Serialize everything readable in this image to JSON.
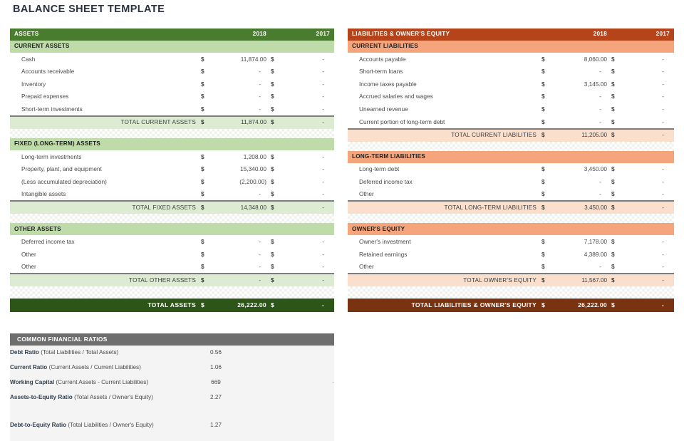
{
  "page": {
    "title": "BALANCE SHEET TEMPLATE"
  },
  "colors": {
    "assets_header": "#4a7c2f",
    "assets_subheader": "#bedba9",
    "assets_total": "#dcebd1",
    "assets_grand": "#2e5518",
    "liabilities_header": "#b5441a",
    "liabilities_subheader": "#f4a57c",
    "liabilities_total": "#fadfcd",
    "liabilities_grand": "#7a3311",
    "ratios_header": "#6e6e6e",
    "title_color": "#2b3342"
  },
  "currency_symbol": "$",
  "dash": "-",
  "assets": {
    "header": {
      "title": "ASSETS",
      "year1": "2018",
      "year2": "2017"
    },
    "sections": [
      {
        "name": "CURRENT ASSETS",
        "rows": [
          {
            "label": "Cash",
            "v2018": "11,874.00",
            "v2017": "-"
          },
          {
            "label": "Accounts receivable",
            "v2018": "-",
            "v2017": "-"
          },
          {
            "label": "Inventory",
            "v2018": "-",
            "v2017": "-"
          },
          {
            "label": "Prepaid expenses",
            "v2018": "-",
            "v2017": "-"
          },
          {
            "label": "Short-term investments",
            "v2018": "-",
            "v2017": "-"
          }
        ],
        "total": {
          "label": "TOTAL CURRENT ASSETS",
          "v2018": "11,874.00",
          "v2017": "-"
        }
      },
      {
        "name": "FIXED (LONG-TERM) ASSETS",
        "rows": [
          {
            "label": "Long-term investments",
            "v2018": "1,208.00",
            "v2017": "-"
          },
          {
            "label": "Property, plant, and equipment",
            "v2018": "15,340.00",
            "v2017": "-"
          },
          {
            "label": "(Less accumulated depreciation)",
            "v2018": "(2,200.00)",
            "v2017": "-"
          },
          {
            "label": "Intangible assets",
            "v2018": "-",
            "v2017": "-"
          }
        ],
        "total": {
          "label": "TOTAL FIXED ASSETS",
          "v2018": "14,348.00",
          "v2017": "-"
        }
      },
      {
        "name": "OTHER ASSETS",
        "rows": [
          {
            "label": "Deferred income tax",
            "v2018": "-",
            "v2017": "-"
          },
          {
            "label": "Other",
            "v2018": "-",
            "v2017": "-"
          },
          {
            "label": "Other",
            "v2018": "-",
            "v2017": "-"
          }
        ],
        "total": {
          "label": "TOTAL OTHER ASSETS",
          "v2018": "-",
          "v2017": "-"
        }
      }
    ],
    "grand_total": {
      "label": "TOTAL ASSETS",
      "v2018": "26,222.00",
      "v2017": "-"
    }
  },
  "liabilities": {
    "header": {
      "title": "LIABILITIES & OWNER'S EQUITY",
      "year1": "2018",
      "year2": "2017"
    },
    "sections": [
      {
        "name": "CURRENT LIABILITIES",
        "rows": [
          {
            "label": "Accounts payable",
            "v2018": "8,060.00",
            "v2017": "-"
          },
          {
            "label": "Short-term loans",
            "v2018": "-",
            "v2017": "-"
          },
          {
            "label": "Income taxes payable",
            "v2018": "3,145.00",
            "v2017": "-"
          },
          {
            "label": "Accrued salaries and wages",
            "v2018": "-",
            "v2017": "-"
          },
          {
            "label": "Unearned revenue",
            "v2018": "-",
            "v2017": "-"
          },
          {
            "label": "Current portion of long-term debt",
            "v2018": "-",
            "v2017": "-"
          }
        ],
        "total": {
          "label": "TOTAL CURRENT LIABILITIES",
          "v2018": "11,205.00",
          "v2017": "-"
        }
      },
      {
        "name": "LONG-TERM LIABILITIES",
        "rows": [
          {
            "label": "Long-term debt",
            "v2018": "3,450.00",
            "v2017": "-"
          },
          {
            "label": "Deferred income tax",
            "v2018": "-",
            "v2017": "-"
          },
          {
            "label": "Other",
            "v2018": "-",
            "v2017": "-"
          }
        ],
        "total": {
          "label": "TOTAL LONG-TERM LIABILITIES",
          "v2018": "3,450.00",
          "v2017": "-"
        }
      },
      {
        "name": "OWNER'S EQUITY",
        "rows": [
          {
            "label": "Owner's investment",
            "v2018": "7,178.00",
            "v2017": "-"
          },
          {
            "label": "Retained earnings",
            "v2018": "4,389.00",
            "v2017": "-"
          },
          {
            "label": "Other",
            "v2018": "-",
            "v2017": "-"
          }
        ],
        "total": {
          "label": "TOTAL OWNER'S EQUITY",
          "v2018": "11,567.00",
          "v2017": "-"
        }
      }
    ],
    "grand_total": {
      "label": "TOTAL LIABILITIES & OWNER'S EQUITY",
      "v2018": "26,222.00",
      "v2017": "-"
    }
  },
  "ratios": {
    "header": "COMMON FINANCIAL RATIOS",
    "rows": [
      {
        "name": "Debt Ratio",
        "formula": "(Total Liabilities / Total Assets)",
        "value": "0.56",
        "extra": ""
      },
      {
        "name": "Current Ratio",
        "formula": "(Current Assets / Current Liabilities)",
        "value": "1.06",
        "extra": ""
      },
      {
        "name": "Working Capital",
        "formula": "(Current Assets - Current Liabilities)",
        "value": "669",
        "extra": "-"
      },
      {
        "name": "Assets-to-Equity Ratio",
        "formula": "(Total Assets / Owner's Equity)",
        "value": "2.27",
        "extra": ""
      },
      {
        "name": "Debt-to-Equity Ratio",
        "formula": "(Total Liabilities / Owner's Equity)",
        "value": "1.27",
        "extra": ""
      }
    ]
  }
}
